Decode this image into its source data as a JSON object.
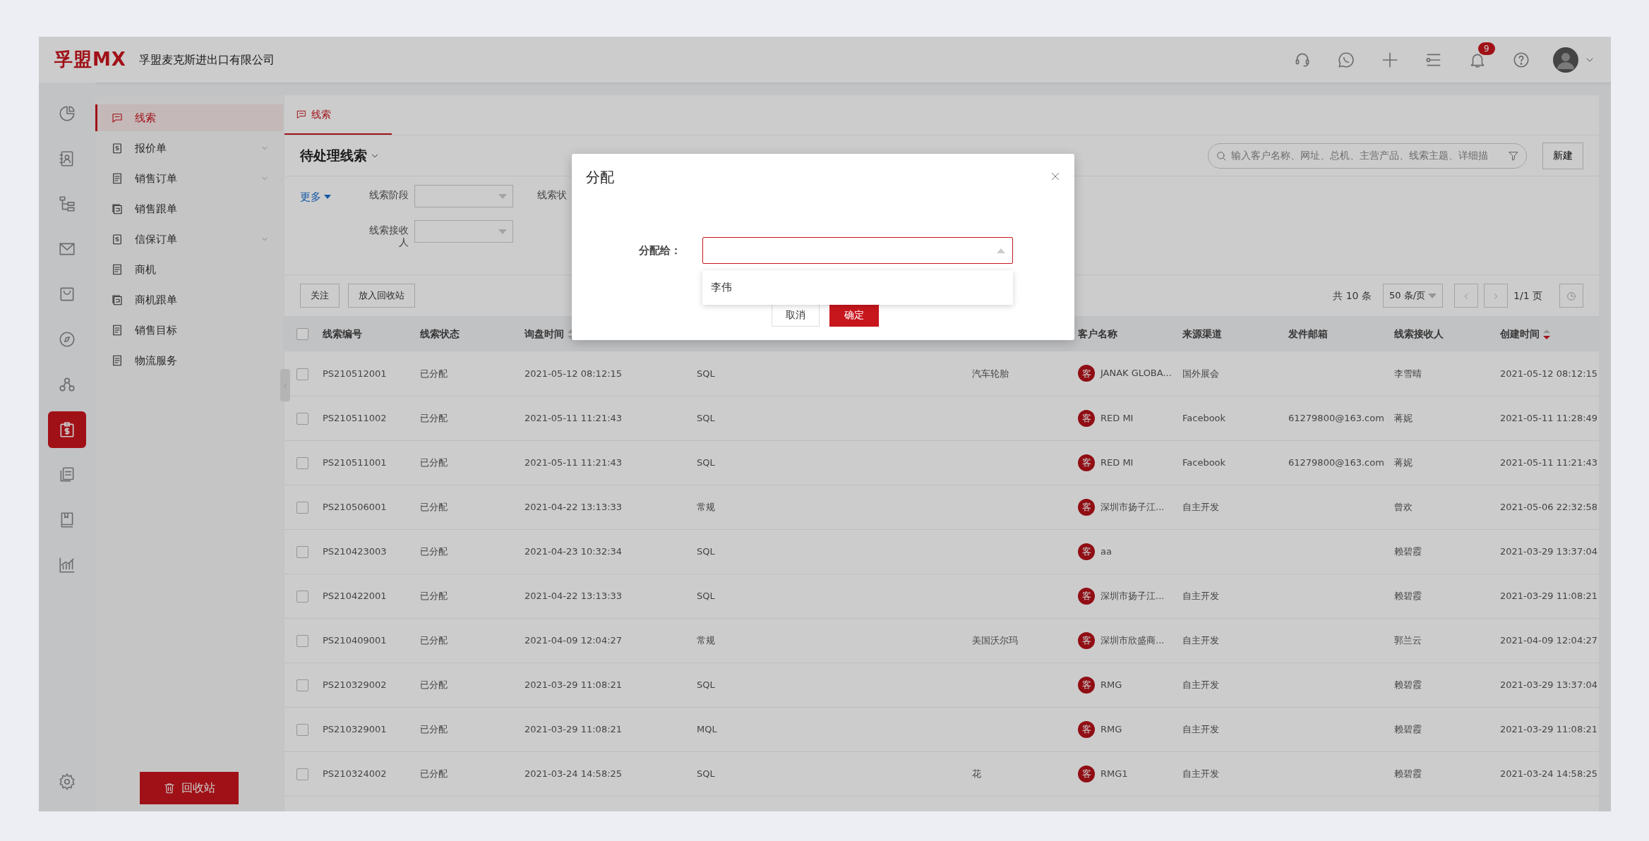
{
  "app": {
    "logo": "孚盟MX",
    "company": "孚盟麦克斯进出口有限公司"
  },
  "topbar": {
    "notification_count": "9"
  },
  "rail": [
    {
      "selected": false
    },
    {
      "selected": false
    },
    {
      "selected": false
    },
    {
      "selected": false
    },
    {
      "selected": false
    },
    {
      "selected": false
    },
    {
      "selected": false
    },
    {
      "selected": true
    },
    {
      "selected": false
    },
    {
      "selected": false
    },
    {
      "selected": false
    }
  ],
  "sidebar": {
    "items": [
      {
        "label": "线索",
        "selected": true,
        "has_submenu": false
      },
      {
        "label": "报价单",
        "selected": false,
        "has_submenu": true
      },
      {
        "label": "销售订单",
        "selected": false,
        "has_submenu": true
      },
      {
        "label": "销售跟单",
        "selected": false,
        "has_submenu": false
      },
      {
        "label": "信保订单",
        "selected": false,
        "has_submenu": true
      },
      {
        "label": "商机",
        "selected": false,
        "has_submenu": false
      },
      {
        "label": "商机跟单",
        "selected": false,
        "has_submenu": false
      },
      {
        "label": "销售目标",
        "selected": false,
        "has_submenu": false
      },
      {
        "label": "物流服务",
        "selected": false,
        "has_submenu": false
      }
    ],
    "recycle_button": "回收站"
  },
  "tabs": [
    {
      "label": "线索",
      "selected": true
    }
  ],
  "view_title": "待处理线索",
  "search": {
    "placeholder": "输入客户名称、网址、总机、主营产品、线索主题、详细描"
  },
  "new_button": "新建",
  "filters": {
    "more": "更多",
    "fields": [
      {
        "label": "线索阶段",
        "kind": "select"
      },
      {
        "label": "线索状",
        "kind": "label"
      },
      {
        "label": "线索接收人",
        "kind": "select"
      }
    ]
  },
  "actions": [
    "关注",
    "放入回收站"
  ],
  "pagination": {
    "total": "共 10 条",
    "page_size": "50 条/页",
    "page": "1/1 页"
  },
  "table": {
    "select_all_checked": false,
    "columns": [
      {
        "label": "线索编号"
      },
      {
        "label": "线索状态"
      },
      {
        "label": "询盘时间",
        "sort_active": false
      },
      {},
      {},
      {},
      {
        "label": "客户名称"
      },
      {
        "label": "来源渠道"
      },
      {
        "label": "发件邮箱"
      },
      {
        "label": "线索接收人"
      },
      {
        "label": "创建时间",
        "sort_active": true
      }
    ],
    "rows": [
      {
        "checked": false,
        "cells": [
          "PS210512001",
          "已分配",
          "2021-05-12 08:12:15",
          "SQL",
          "",
          "汽车轮胎",
          {
            "badge": "客",
            "name": "JANAK GLOBA..."
          },
          "国外展会",
          "",
          "李雪晴",
          "2021-05-12 08:12:15"
        ]
      },
      {
        "checked": false,
        "cells": [
          "PS210511002",
          "已分配",
          "2021-05-11 11:21:43",
          "SQL",
          "",
          "",
          {
            "badge": "客",
            "name": "RED MI"
          },
          "Facebook",
          "61279800@163.com",
          "蒋妮",
          "2021-05-11 11:28:49"
        ]
      },
      {
        "checked": false,
        "cells": [
          "PS210511001",
          "已分配",
          "2021-05-11 11:21:43",
          "SQL",
          "",
          "",
          {
            "badge": "客",
            "name": "RED MI"
          },
          "Facebook",
          "61279800@163.com",
          "蒋妮",
          "2021-05-11 11:21:43"
        ]
      },
      {
        "checked": false,
        "cells": [
          "PS210506001",
          "已分配",
          "2021-04-22 13:13:33",
          "常规",
          "",
          "",
          {
            "badge": "客",
            "name": "深圳市扬子江..."
          },
          "自主开发",
          "",
          "曾欢",
          "2021-05-06 22:32:58"
        ]
      },
      {
        "checked": false,
        "cells": [
          "PS210423003",
          "已分配",
          "2021-04-23 10:32:34",
          "SQL",
          "",
          "",
          {
            "badge": "客",
            "name": "aa"
          },
          "",
          "",
          "赖碧霞",
          "2021-03-29 13:37:04"
        ]
      },
      {
        "checked": false,
        "cells": [
          "PS210422001",
          "已分配",
          "2021-04-22 13:13:33",
          "SQL",
          "",
          "",
          {
            "badge": "客",
            "name": "深圳市扬子江..."
          },
          "自主开发",
          "",
          "赖碧霞",
          "2021-03-29 11:08:21"
        ]
      },
      {
        "checked": false,
        "cells": [
          "PS210409001",
          "已分配",
          "2021-04-09 12:04:27",
          "常规",
          "",
          "美国沃尔玛",
          {
            "badge": "客",
            "name": "深圳市欣盛商..."
          },
          "自主开发",
          "",
          "郭兰云",
          "2021-04-09 12:04:27"
        ]
      },
      {
        "checked": false,
        "cells": [
          "PS210329002",
          "已分配",
          "2021-03-29 11:08:21",
          "SQL",
          "",
          "",
          {
            "badge": "客",
            "name": "RMG"
          },
          "自主开发",
          "",
          "赖碧霞",
          "2021-03-29 13:37:04"
        ]
      },
      {
        "checked": false,
        "cells": [
          "PS210329001",
          "已分配",
          "2021-03-29 11:08:21",
          "MQL",
          "",
          "",
          {
            "badge": "客",
            "name": "RMG"
          },
          "自主开发",
          "",
          "赖碧霞",
          "2021-03-29 11:08:21"
        ]
      },
      {
        "checked": false,
        "cells": [
          "PS210324002",
          "已分配",
          "2021-03-24 14:58:25",
          "SQL",
          "",
          "花",
          {
            "badge": "客",
            "name": "RMG1"
          },
          "自主开发",
          "",
          "赖碧霞",
          "2021-03-24 14:58:25"
        ]
      }
    ]
  },
  "modal": {
    "title": "分配",
    "field_label": "分配给：",
    "options": [
      {
        "label": "李伟",
        "selected": false
      }
    ],
    "cancel": "取消",
    "confirm": "确定"
  }
}
